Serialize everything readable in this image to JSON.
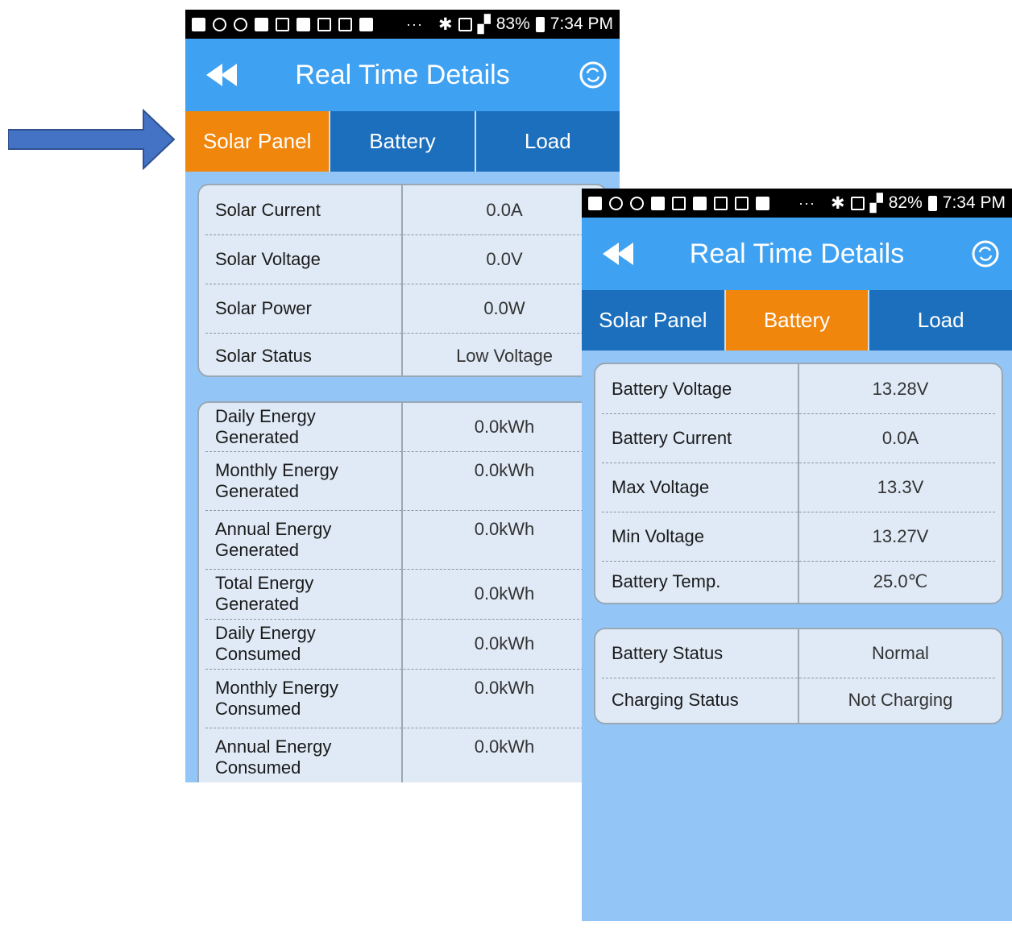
{
  "colors": {
    "appbar": "#3fa1f2",
    "tabbar": "#1b6fbd",
    "tab_active": "#f0860c",
    "background": "#93c6f7",
    "arrow": "#4472c4"
  },
  "left": {
    "status": {
      "battery": "83%",
      "time": "7:34 PM"
    },
    "title": "Real Time Details",
    "tabs": [
      "Solar Panel",
      "Battery",
      "Load"
    ],
    "active_tab": 0,
    "card1": [
      {
        "label": "Solar Current",
        "value": "0.0A"
      },
      {
        "label": "Solar Voltage",
        "value": "0.0V"
      },
      {
        "label": "Solar Power",
        "value": "0.0W"
      },
      {
        "label": "Solar Status",
        "value": "Low Voltage"
      }
    ],
    "card2": [
      {
        "label": "Daily Energy Generated",
        "value": "0.0kWh"
      },
      {
        "label": "Monthly Energy Generated",
        "value": "0.0kWh"
      },
      {
        "label": "Annual Energy Generated",
        "value": "0.0kWh"
      },
      {
        "label": "Total Energy Generated",
        "value": "0.0kWh"
      },
      {
        "label": "Daily Energy Consumed",
        "value": "0.0kWh"
      },
      {
        "label": "Monthly Energy Consumed",
        "value": "0.0kWh"
      },
      {
        "label": "Annual Energy Consumed",
        "value": "0.0kWh"
      }
    ]
  },
  "right": {
    "status": {
      "battery": "82%",
      "time": "7:34 PM"
    },
    "title": "Real Time Details",
    "tabs": [
      "Solar Panel",
      "Battery",
      "Load"
    ],
    "active_tab": 1,
    "card1": [
      {
        "label": "Battery Voltage",
        "value": "13.28V"
      },
      {
        "label": "Battery Current",
        "value": "0.0A"
      },
      {
        "label": "Max Voltage",
        "value": "13.3V"
      },
      {
        "label": "Min Voltage",
        "value": "13.27V"
      },
      {
        "label": "Battery Temp.",
        "value": "25.0℃"
      }
    ],
    "card2": [
      {
        "label": "Battery Status",
        "value": "Normal"
      },
      {
        "label": "Charging Status",
        "value": "Not Charging"
      }
    ]
  }
}
